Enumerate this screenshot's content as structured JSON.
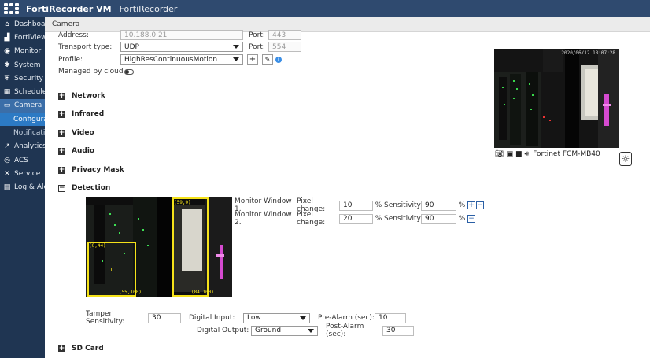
{
  "topbar": {
    "app_name": "FortiRecorder VM",
    "device_name": "FortiRecorder"
  },
  "sidebar": {
    "items": [
      {
        "label": "Dashboard",
        "icon": "dashboard-icon",
        "glyph": "⌂"
      },
      {
        "label": "FortiView",
        "icon": "chart-icon",
        "glyph": "▟"
      },
      {
        "label": "Monitor",
        "icon": "monitor-icon",
        "glyph": "◉"
      },
      {
        "label": "System",
        "icon": "gear-icon",
        "glyph": "✱"
      },
      {
        "label": "Security",
        "icon": "shield-icon",
        "glyph": "⛨"
      },
      {
        "label": "Schedule",
        "icon": "calendar-icon",
        "glyph": "▦"
      },
      {
        "label": "Camera",
        "icon": "camera-icon",
        "glyph": "▭"
      },
      {
        "label": "Configuration",
        "icon": "",
        "glyph": ""
      },
      {
        "label": "Notifications",
        "icon": "",
        "glyph": ""
      },
      {
        "label": "Analytics",
        "icon": "analytics-icon",
        "glyph": "↗"
      },
      {
        "label": "ACS",
        "icon": "acs-icon",
        "glyph": "◎"
      },
      {
        "label": "Service",
        "icon": "wrench-icon",
        "glyph": "✕"
      },
      {
        "label": "Log & Alerts",
        "icon": "log-icon",
        "glyph": "▤"
      }
    ]
  },
  "panel": {
    "title": "Camera"
  },
  "form": {
    "address_label": "Address:",
    "address_value": "10.188.0.21",
    "port_label": "Port:",
    "port1_value": "443",
    "transport_label": "Transport type:",
    "transport_value": "UDP",
    "port2_value": "554",
    "profile_label": "Profile:",
    "profile_value": "HighResContinuousMotion",
    "managed_label": "Managed by cloud"
  },
  "sections": {
    "network": "Network",
    "infrared": "Infrared",
    "video": "Video",
    "audio": "Audio",
    "privacy_mask": "Privacy Mask",
    "detection": "Detection",
    "sd_card": "SD Card"
  },
  "preview": {
    "camera_name": "Fortinet FCM-MB40",
    "timestamp": "2020/06/12 18:07:28"
  },
  "detection": {
    "windows": [
      {
        "label": "Monitor Window 1.",
        "pixel_label": "Pixel change:",
        "pixel_value": "10",
        "pct": "%",
        "sens_label": "Sensitivity:",
        "sens_value": "90"
      },
      {
        "label": "Monitor Window 2.",
        "pixel_label": "Pixel change:",
        "pixel_value": "20",
        "pct": "%",
        "sens_label": "Sensitivity:",
        "sens_value": "90"
      }
    ],
    "window1_start": "(0,44)",
    "window1_end": "(55,100)",
    "window1_id": "1",
    "window2_start": "(59,0)",
    "window2_end": "(84,100)",
    "tamper_label": "Tamper Sensitivity:",
    "tamper_value": "30",
    "digital_input_label": "Digital Input:",
    "digital_input_value": "Low",
    "digital_output_label": "Digital Output:",
    "digital_output_value": "Ground",
    "pre_alarm_label": "Pre-Alarm (sec):",
    "pre_alarm_value": "10",
    "post_alarm_label": "Post-Alarm (sec):",
    "post_alarm_value": "30"
  },
  "colors": {
    "topbar": "#2f4a6f",
    "sidebar": "#1f3552",
    "highlight": "#2c7ac4",
    "window_box": "#f5e21a"
  }
}
